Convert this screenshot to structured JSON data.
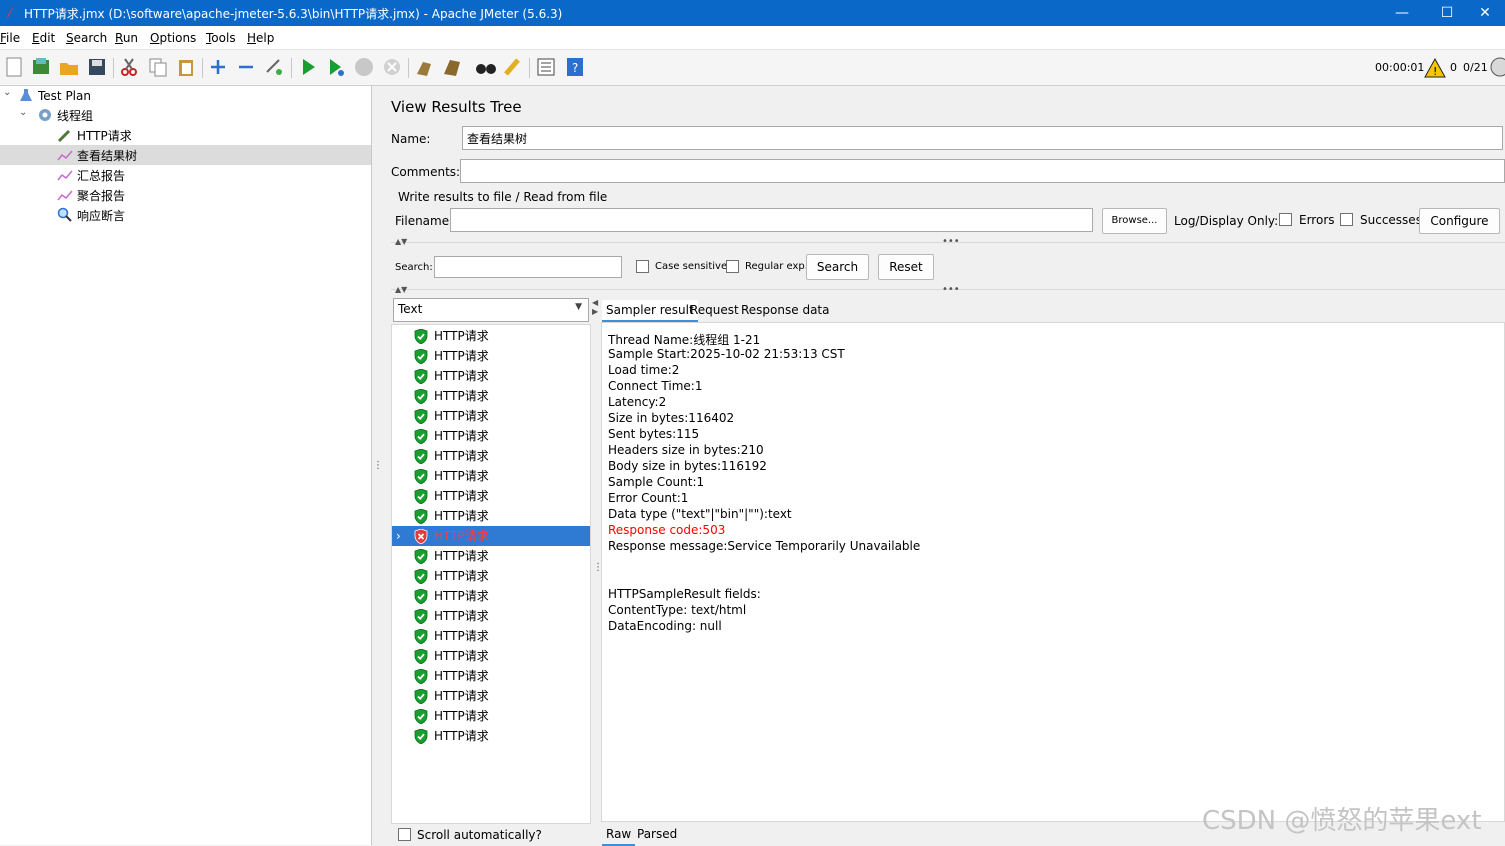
{
  "window": {
    "title": "HTTP请求.jmx (D:\\software\\apache-jmeter-5.6.3\\bin\\HTTP请求.jmx) - Apache JMeter (5.6.3)",
    "minimize": "—",
    "maximize": "☐",
    "close": "✕"
  },
  "menu": [
    "File",
    "Edit",
    "Search",
    "Run",
    "Options",
    "Tools",
    "Help"
  ],
  "toolbar": {
    "elapsed": "00:00:01",
    "warning_count": "0",
    "threads": "0/21"
  },
  "tree": [
    {
      "label": "Test Plan",
      "icon": "test-plan-icon"
    },
    {
      "label": "线程组",
      "icon": "gear-icon"
    },
    {
      "label": "HTTP请求",
      "icon": "pipette-icon"
    },
    {
      "label": "查看结果树",
      "icon": "chart-icon"
    },
    {
      "label": "汇总报告",
      "icon": "chart-icon"
    },
    {
      "label": "聚合报告",
      "icon": "chart-icon"
    },
    {
      "label": "响应断言",
      "icon": "magnifier-icon"
    }
  ],
  "panel": {
    "title": "View Results Tree",
    "name_label": "Name:",
    "name_value": "查看结果树",
    "comments_label": "Comments:",
    "comments_value": "",
    "file_section": "Write results to file / Read from file",
    "filename_label": "Filename",
    "filename_value": "",
    "browse": "Browse...",
    "log_display_only": "Log/Display Only:",
    "errors": "Errors",
    "successes": "Successes",
    "configure": "Configure",
    "search_label": "Search:",
    "search_value": "",
    "case_sensitive": "Case sensitive",
    "regular_exp": "Regular exp.",
    "search_btn": "Search",
    "reset_btn": "Reset",
    "renderer": "Text",
    "scroll_auto": "Scroll automatically?"
  },
  "results": [
    {
      "label": "HTTP请求",
      "status": "success"
    },
    {
      "label": "HTTP请求",
      "status": "success"
    },
    {
      "label": "HTTP请求",
      "status": "success"
    },
    {
      "label": "HTTP请求",
      "status": "success"
    },
    {
      "label": "HTTP请求",
      "status": "success"
    },
    {
      "label": "HTTP请求",
      "status": "success"
    },
    {
      "label": "HTTP请求",
      "status": "success"
    },
    {
      "label": "HTTP请求",
      "status": "success"
    },
    {
      "label": "HTTP请求",
      "status": "success"
    },
    {
      "label": "HTTP请求",
      "status": "success"
    },
    {
      "label": "HTTP请求",
      "status": "error"
    },
    {
      "label": "HTTP请求",
      "status": "success"
    },
    {
      "label": "HTTP请求",
      "status": "success"
    },
    {
      "label": "HTTP请求",
      "status": "success"
    },
    {
      "label": "HTTP请求",
      "status": "success"
    },
    {
      "label": "HTTP请求",
      "status": "success"
    },
    {
      "label": "HTTP请求",
      "status": "success"
    },
    {
      "label": "HTTP请求",
      "status": "success"
    },
    {
      "label": "HTTP请求",
      "status": "success"
    },
    {
      "label": "HTTP请求",
      "status": "success"
    },
    {
      "label": "HTTP请求",
      "status": "success"
    }
  ],
  "tabs": [
    "Sampler result",
    "Request",
    "Response data"
  ],
  "bottom_tabs": [
    "Raw",
    "Parsed"
  ],
  "detail_lines": [
    {
      "text": "Thread Name:线程组 1-21",
      "color": "#000000"
    },
    {
      "text": "Sample Start:2025-10-02 21:53:13 CST",
      "color": "#000000"
    },
    {
      "text": "Load time:2",
      "color": "#000000"
    },
    {
      "text": "Connect Time:1",
      "color": "#000000"
    },
    {
      "text": "Latency:2",
      "color": "#000000"
    },
    {
      "text": "Size in bytes:116402",
      "color": "#000000"
    },
    {
      "text": "Sent bytes:115",
      "color": "#000000"
    },
    {
      "text": "Headers size in bytes:210",
      "color": "#000000"
    },
    {
      "text": "Body size in bytes:116192",
      "color": "#000000"
    },
    {
      "text": "Sample Count:1",
      "color": "#000000"
    },
    {
      "text": "Error Count:1",
      "color": "#000000"
    },
    {
      "text": "Data type (\"text\"|\"bin\"|\"\"):text",
      "color": "#000000"
    },
    {
      "text": "Response code:503",
      "color": "#ff0000"
    },
    {
      "text": "Response message:Service Temporarily Unavailable",
      "color": "#000000"
    },
    {
      "text": "",
      "color": "#000000"
    },
    {
      "text": "",
      "color": "#000000"
    },
    {
      "text": "HTTPSampleResult fields:",
      "color": "#000000"
    },
    {
      "text": "ContentType: text/html",
      "color": "#000000"
    },
    {
      "text": "DataEncoding: null",
      "color": "#000000"
    }
  ],
  "watermark": "CSDN @愤怒的苹果ext",
  "colors": {
    "titlebar": "#0a68c9",
    "selection": "#2f7ad2",
    "error_text": "#ff0000",
    "success": "#1a9e2f"
  }
}
